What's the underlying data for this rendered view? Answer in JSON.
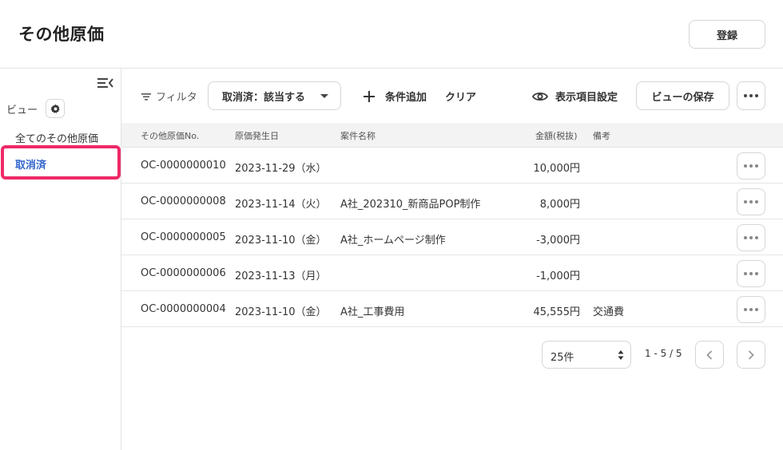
{
  "header": {
    "title": "その他原価",
    "register_label": "登録"
  },
  "sidebar": {
    "view_label": "ビュー",
    "items": [
      {
        "label": "全てのその他原価",
        "active": false
      },
      {
        "label": "取消済",
        "active": true
      }
    ]
  },
  "toolbar": {
    "filter_label": "フィルタ",
    "filter_chip": "取消済：該当する",
    "add_condition": "条件追加",
    "clear": "クリア",
    "column_settings": "表示項目設定",
    "save_view": "ビューの保存"
  },
  "table": {
    "columns": [
      "その他原価No.",
      "原価発生日",
      "案件名称",
      "金額(税抜)",
      "備考"
    ],
    "rows": [
      {
        "no": "OC-0000000010",
        "date": "2023-11-29（水）",
        "name": "",
        "amount": "10,000円",
        "note": ""
      },
      {
        "no": "OC-0000000008",
        "date": "2023-11-14（火）",
        "name": "A社_202310_新商品POP制作",
        "amount": "8,000円",
        "note": ""
      },
      {
        "no": "OC-0000000005",
        "date": "2023-11-10（金）",
        "name": "A社_ホームページ制作",
        "amount": "-3,000円",
        "note": ""
      },
      {
        "no": "OC-0000000006",
        "date": "2023-11-13（月）",
        "name": "",
        "amount": "-1,000円",
        "note": ""
      },
      {
        "no": "OC-0000000004",
        "date": "2023-11-10（金）",
        "name": "A社_工事費用",
        "amount": "45,555円",
        "note": "交通費"
      }
    ]
  },
  "pagination": {
    "page_size": "25件",
    "range": "1 - 5 / 5"
  },
  "colors": {
    "active_link": "#3366cc",
    "highlight": "#ee2a67"
  }
}
